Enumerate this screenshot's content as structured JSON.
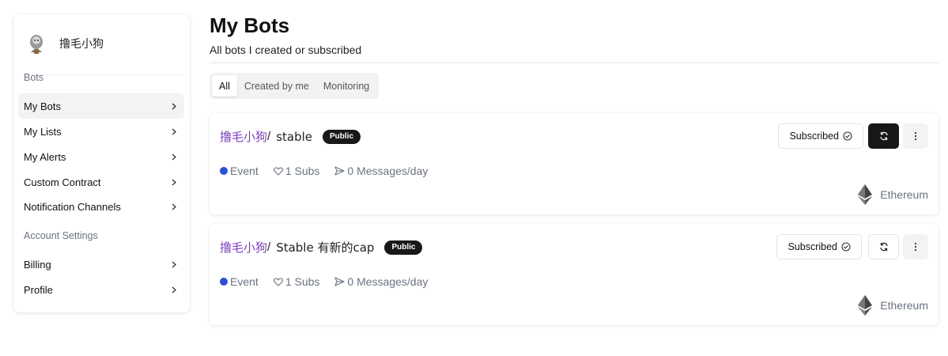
{
  "sidebar": {
    "user": {
      "name": "撸毛小狗"
    },
    "sections": [
      {
        "label": "Bots",
        "items": [
          {
            "label": "My Bots",
            "active": true
          },
          {
            "label": "My Lists",
            "active": false
          },
          {
            "label": "My Alerts",
            "active": false
          },
          {
            "label": "Custom Contract",
            "active": false
          },
          {
            "label": "Notification Channels",
            "active": false
          }
        ]
      },
      {
        "label": "Account Settings",
        "items": [
          {
            "label": "Billing",
            "active": false
          },
          {
            "label": "Profile",
            "active": false
          }
        ]
      }
    ]
  },
  "header": {
    "title": "My Bots",
    "subtitle": "All bots I created or subscribed"
  },
  "tabs": [
    {
      "label": "All",
      "active": true
    },
    {
      "label": "Created by me",
      "active": false
    },
    {
      "label": "Monitoring",
      "active": false
    }
  ],
  "bots": [
    {
      "owner": "撸毛小狗",
      "separator": "/",
      "name": "stable",
      "visibility": "Public",
      "status_label": "Subscribed",
      "type": "Event",
      "subs": "1 Subs",
      "messages": "0 Messages/day",
      "chain": "Ethereum",
      "icon_button_style": "dark"
    },
    {
      "owner": "撸毛小狗",
      "separator": "/",
      "name": "Stable 有新的cap",
      "visibility": "Public",
      "status_label": "Subscribed",
      "type": "Event",
      "subs": "1 Subs",
      "messages": "0 Messages/day",
      "chain": "Ethereum",
      "icon_button_style": "light"
    }
  ],
  "colors": {
    "accent_owner": "#7b3fbf",
    "event_dot": "#2b4fd6",
    "badge_bg": "#18181b"
  }
}
